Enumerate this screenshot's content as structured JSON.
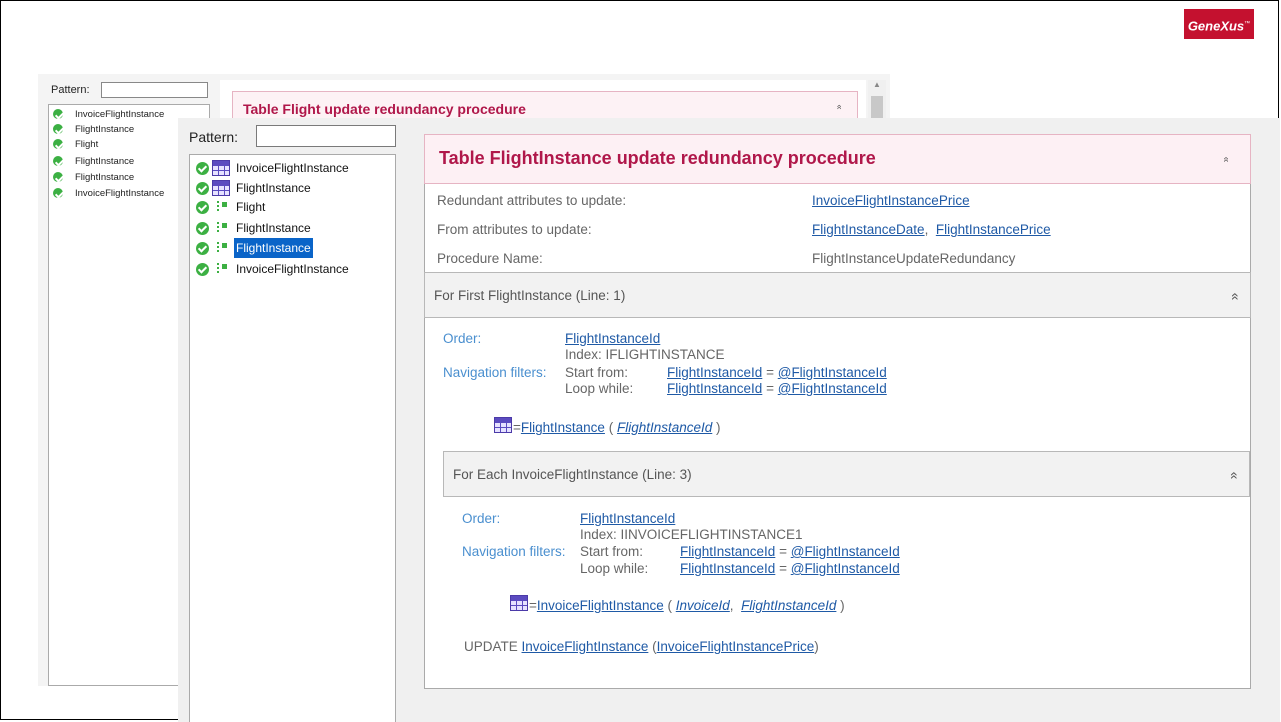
{
  "brand": {
    "logo_text": "GeneXus",
    "logo_mark": "™",
    "color": "#c4112f"
  },
  "back_window": {
    "pattern_label": "Pattern:",
    "tree": [
      "InvoiceFlightInstance",
      "FlightInstance",
      "Flight",
      "FlightInstance",
      "FlightInstance",
      "InvoiceFlightInstance"
    ],
    "header_title": "Table Flight update redundancy procedure"
  },
  "tree_panel": {
    "pattern_label": "Pattern:",
    "pattern_value": "",
    "items": [
      {
        "label": "InvoiceFlightInstance",
        "icon": "table-icon"
      },
      {
        "label": "FlightInstance",
        "icon": "table-icon"
      },
      {
        "label": "Flight",
        "icon": "navigation-icon"
      },
      {
        "label": "FlightInstance",
        "icon": "navigation-icon"
      },
      {
        "label": "FlightInstance",
        "icon": "navigation-icon",
        "selected": true
      },
      {
        "label": "InvoiceFlightInstance",
        "icon": "navigation-icon"
      }
    ]
  },
  "main": {
    "title": "Table FlightInstance update redundancy procedure",
    "props": {
      "redundant_label": "Redundant attributes to update:",
      "redundant_value": "InvoiceFlightInstancePrice",
      "from_label": "From attributes to update:",
      "from_value_1": "FlightInstanceDate",
      "from_sep": ",",
      "from_value_2": "FlightInstancePrice",
      "procname_label": "Procedure Name:",
      "procname_value": "FlightInstanceUpdateRedundancy"
    },
    "for_first": {
      "title": "For First FlightInstance (Line: 1)",
      "order_label": "Order:",
      "order_value": "FlightInstanceId",
      "index": "Index: IFLIGHTINSTANCE",
      "nav_label": "Navigation filters:",
      "start_label": "Start from:",
      "start_attr": "FlightInstanceId",
      "start_eq": "=",
      "start_var": "@FlightInstanceId",
      "loop_label": "Loop while:",
      "loop_attr": "FlightInstanceId",
      "loop_eq": "=",
      "loop_var": "@FlightInstanceId",
      "table_prefix": "=",
      "table_name": "FlightInstance",
      "table_open": "(",
      "table_key": "FlightInstanceId",
      "table_close": ")"
    },
    "for_each": {
      "title": "For Each InvoiceFlightInstance (Line: 3)",
      "order_label": "Order:",
      "order_value": "FlightInstanceId",
      "index": "Index: IINVOICEFLIGHTINSTANCE1",
      "nav_label": "Navigation filters:",
      "start_label": "Start from:",
      "start_attr": "FlightInstanceId",
      "start_eq": "=",
      "start_var": "@FlightInstanceId",
      "loop_label": "Loop while:",
      "loop_attr": "FlightInstanceId",
      "loop_eq": "=",
      "loop_var": "@FlightInstanceId",
      "table_prefix": "=",
      "table_name": "InvoiceFlightInstance",
      "table_open": "(",
      "table_key_1": "InvoiceId",
      "table_sep": ",",
      "table_key_2": "FlightInstanceId",
      "table_close": ")",
      "update_kw": "UPDATE",
      "update_table": "InvoiceFlightInstance",
      "update_open": "(",
      "update_attr": "InvoiceFlightInstancePrice",
      "update_close": ")"
    },
    "collapse_glyph": "»"
  }
}
